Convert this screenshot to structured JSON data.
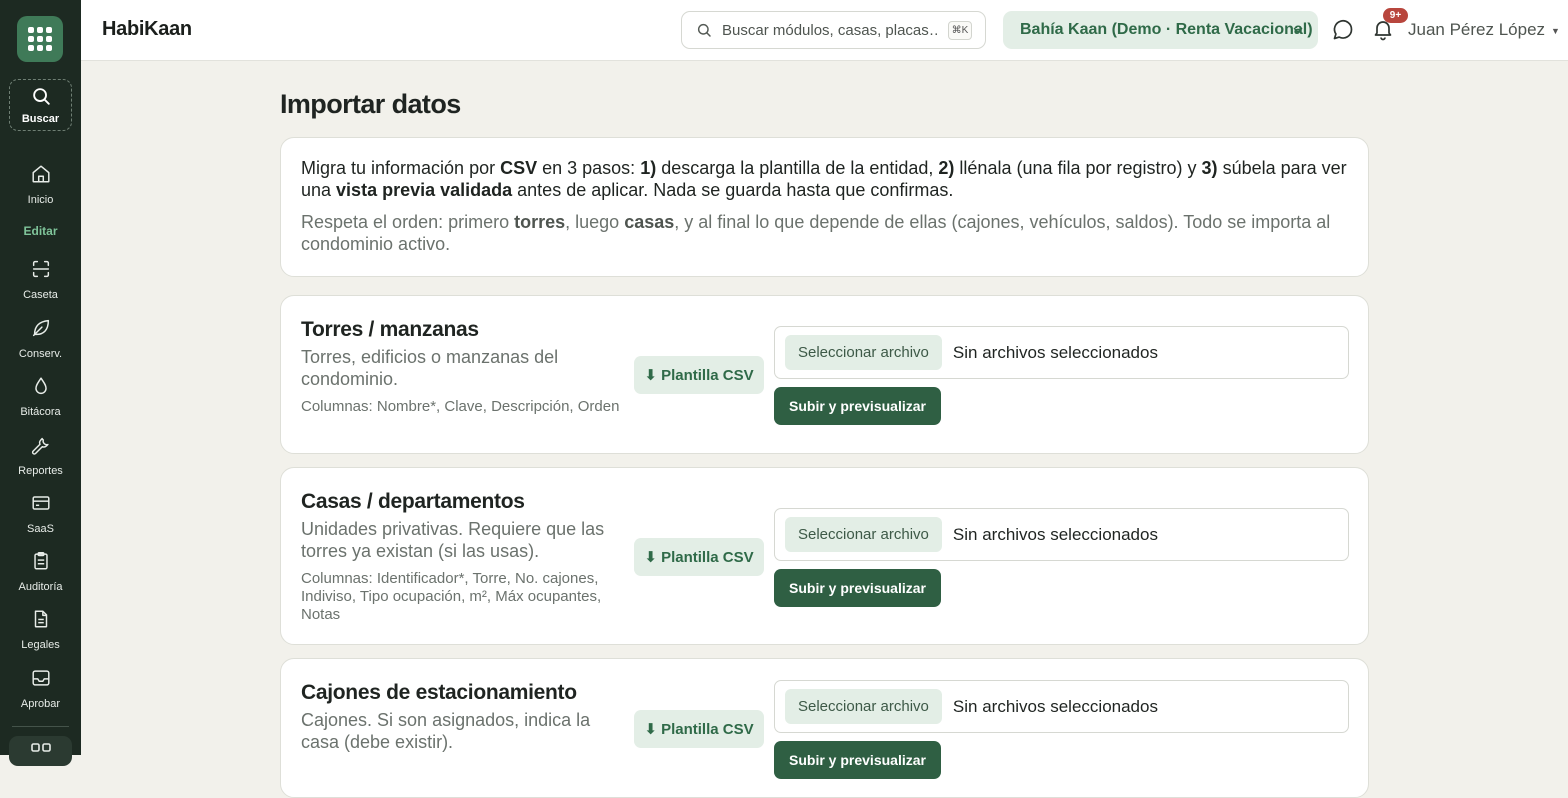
{
  "app": {
    "brand": "HabiKaan"
  },
  "sidebar": {
    "search_label": "Buscar",
    "section_label": "Editar",
    "items": [
      {
        "label": "Inicio",
        "icon": "home-icon"
      },
      {
        "label": "Caseta",
        "icon": "scan-icon"
      },
      {
        "label": "Conserv.",
        "icon": "leaf-icon"
      },
      {
        "label": "Bitácora",
        "icon": "drop-icon"
      },
      {
        "label": "Reportes",
        "icon": "wrench-icon"
      },
      {
        "label": "SaaS",
        "icon": "card-icon"
      },
      {
        "label": "Auditoría",
        "icon": "clipboard-icon"
      },
      {
        "label": "Legales",
        "icon": "document-icon"
      },
      {
        "label": "Aprobar",
        "icon": "inbox-icon"
      }
    ]
  },
  "header": {
    "search_placeholder": "Buscar módulos, casas, placas…",
    "search_shortcut": "⌘K",
    "condo_selected": "Bahía Kaan (Demo · Renta Vacacional)",
    "notifications_badge": "9+",
    "user_name": "Juan Pérez López"
  },
  "main": {
    "title": "Importar datos",
    "intro": {
      "l1_a": "Migra tu información por ",
      "l1_b": "CSV",
      "l1_c": " en 3 pasos: ",
      "l1_d": "1)",
      "l1_e": " descarga la plantilla de la entidad, ",
      "l1_f": "2)",
      "l1_g": " llénala (una fila por registro) y ",
      "l1_h": "3)",
      "l1_i": " súbela para ver una ",
      "l1_j": "vista previa validada",
      "l1_k": " antes de aplicar. Nada se guarda hasta que confirmas.",
      "l2_a": "Respeta el orden: primero ",
      "l2_b": "torres",
      "l2_c": ", luego ",
      "l2_d": "casas",
      "l2_e": ", y al final lo que depende de ellas (cajones, vehículos, saldos). Todo se importa al condominio activo."
    },
    "template_label": "⬇ Plantilla CSV",
    "file_button_label": "Seleccionar archivo",
    "file_status": "Sin archivos seleccionados",
    "upload_label": "Subir y previsualizar",
    "entities": [
      {
        "title": "Torres / manzanas",
        "description": "Torres, edificios o manzanas del condominio.",
        "columns": "Columnas: Nombre*, Clave, Descripción, Orden"
      },
      {
        "title": "Casas / departamentos",
        "description": "Unidades privativas. Requiere que las torres ya existan (si las usas).",
        "columns": "Columnas: Identificador*, Torre, No. cajones, Indiviso, Tipo ocupación, m², Máx ocupantes, Notas"
      },
      {
        "title": "Cajones de estacionamiento",
        "description": "Cajones. Si son asignados, indica la casa (debe existir).",
        "columns": ""
      }
    ]
  }
}
